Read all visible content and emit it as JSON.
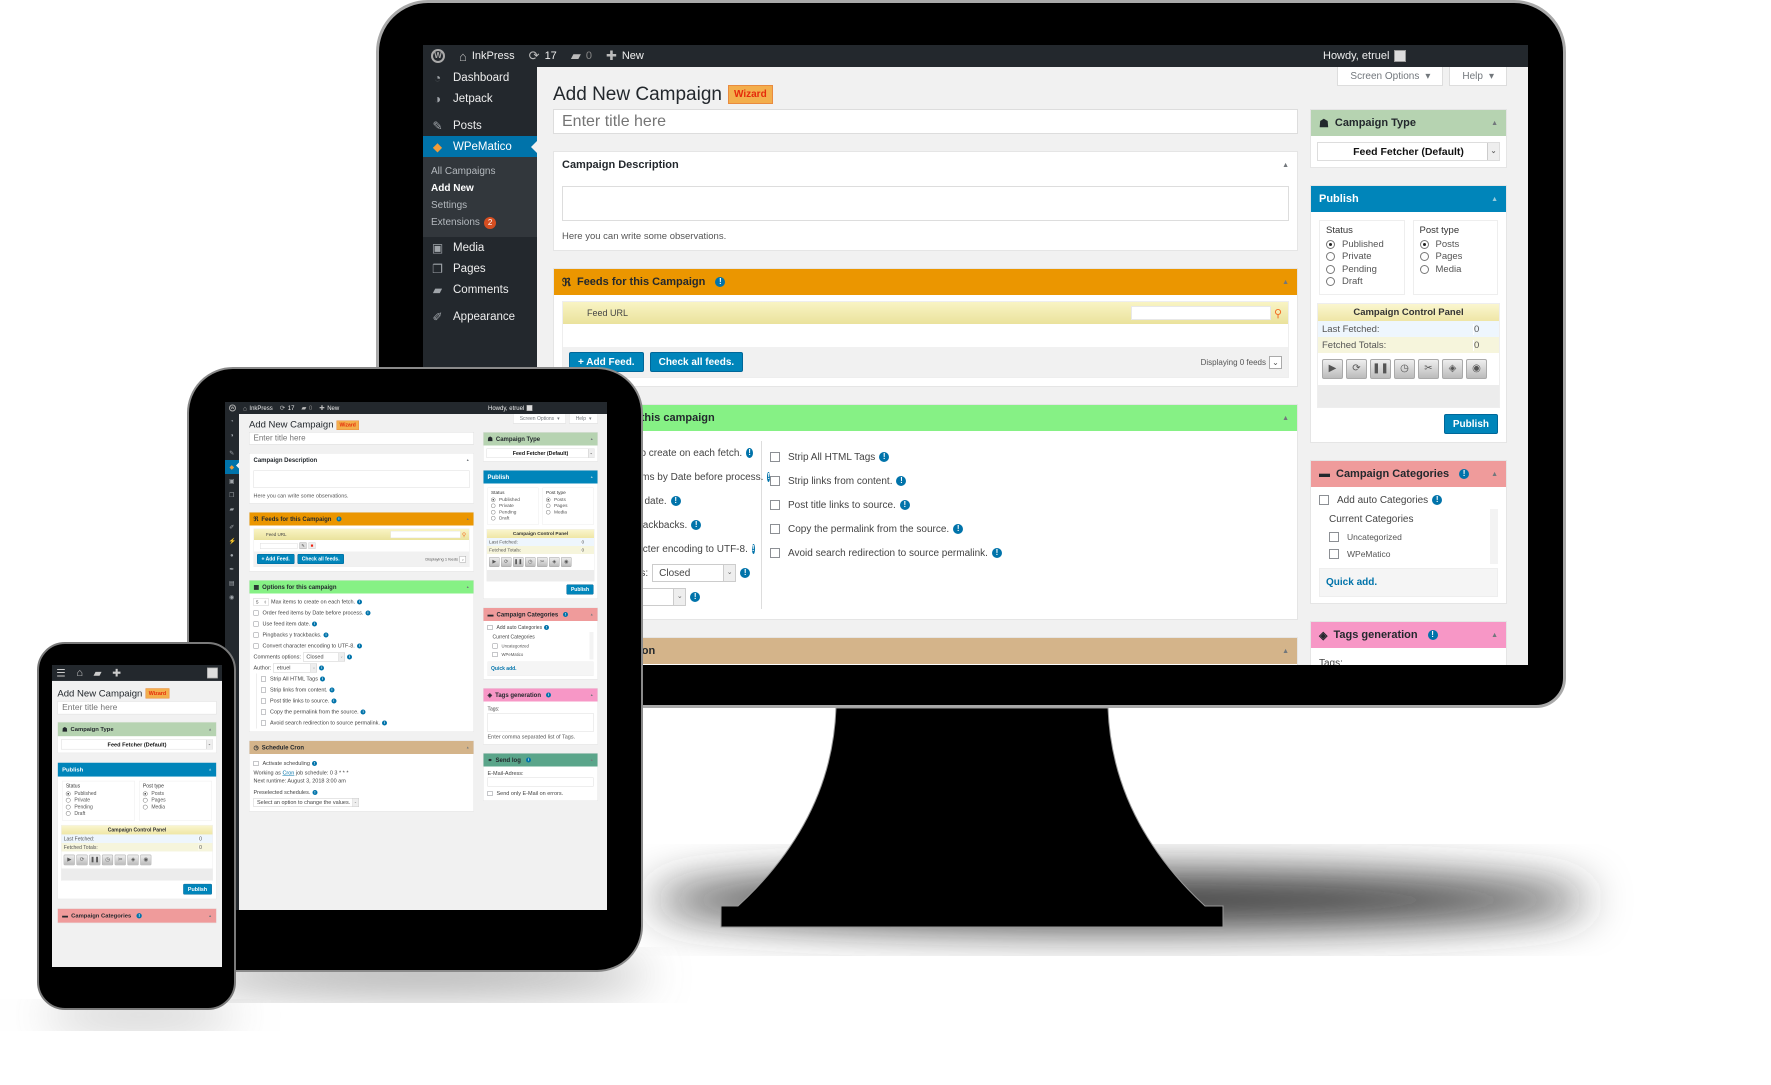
{
  "adminbar": {
    "site": "InkPress",
    "updates": "17",
    "comments": "0",
    "new": "New",
    "howdy": "Howdy, etruel"
  },
  "sidebar": {
    "items": [
      {
        "label": "Dashboard",
        "icon": "dashboard-icon"
      },
      {
        "label": "Jetpack",
        "icon": "jetpack-icon"
      },
      {
        "label": "Posts",
        "icon": "pin-icon"
      },
      {
        "label": "WPeMatico",
        "icon": "wpematico-icon"
      },
      {
        "label": "Media",
        "icon": "media-icon"
      },
      {
        "label": "Pages",
        "icon": "pages-icon"
      },
      {
        "label": "Comments",
        "icon": "comment-icon"
      },
      {
        "label": "Appearance",
        "icon": "brush-icon"
      }
    ],
    "icon_only_items": [
      "plugins-icon",
      "users-icon",
      "tools-icon",
      "settings-icon",
      "collapse-icon"
    ],
    "submenu": [
      "All Campaigns",
      "Add New",
      "Settings",
      "Extensions"
    ],
    "extensions_badge": "2"
  },
  "screen_options": "Screen Options",
  "help": "Help",
  "page_title": "Add New Campaign",
  "wizard": "Wizard",
  "title_placeholder": "Enter title here",
  "description": {
    "title": "Campaign Description",
    "hint": "Here you can write some observations."
  },
  "feeds": {
    "title": "Feeds for this Campaign",
    "feed_url": "Feed URL",
    "add_feed": "+ Add Feed.",
    "check_all": "Check all feeds.",
    "displaying_monitor": "Displaying 0 feeds",
    "displaying_tablet": "Displaying 1 feeds"
  },
  "options": {
    "title": "Options for this campaign",
    "max_items_value": "5",
    "max_items": "Max items to create on each fetch.",
    "checks_left": [
      "Order feed items by Date before process.",
      "Use feed item date.",
      "Pingbacks y trackbacks.",
      "Convert character encoding to UTF-8."
    ],
    "comments_label": "Comments options:",
    "comments_value": "Closed",
    "author_label": "Author:",
    "author_value": "etruel",
    "checks_right": [
      "Strip All HTML Tags",
      "Strip links from content.",
      "Post title links to source.",
      "Copy the permalink from the source.",
      "Avoid search redirection to source permalink."
    ]
  },
  "schedule": {
    "title": "Schedule Cron",
    "activate": "Activate scheduling",
    "working_prefix": "Working as",
    "cron_link": "Cron",
    "working_suffix": "job schedule: 0 3 * * *",
    "next_runtime": "Next runtime: August 3, 2018 3:00 am",
    "preselected": "Preselected schedules.",
    "select_placeholder": "Select an option to change the values."
  },
  "campaign_type": {
    "title": "Campaign Type",
    "value": "Feed Fetcher (Default)"
  },
  "publish": {
    "title": "Publish",
    "status_label": "Status",
    "statuses": [
      "Published",
      "Private",
      "Pending",
      "Draft"
    ],
    "selected_status": "Published",
    "post_type_label": "Post type",
    "post_types": [
      "Posts",
      "Pages",
      "Media"
    ],
    "selected_post_type": "Posts",
    "control_panel": "Campaign Control Panel",
    "last_fetched_label": "Last Fetched:",
    "last_fetched": "0",
    "fetched_totals_label": "Fetched Totals:",
    "fetched_totals": "0",
    "control_buttons": [
      "play-icon",
      "refresh-icon",
      "pause-icon",
      "history-icon",
      "unlink-icon",
      "tag-icon",
      "eye-icon"
    ],
    "button": "Publish"
  },
  "categories": {
    "title": "Campaign Categories",
    "auto": "Add auto Categories",
    "current": "Current Categories",
    "items": [
      "Uncategorized",
      "WPeMatico"
    ],
    "quick_add": "Quick add."
  },
  "tags": {
    "title": "Tags generation",
    "label": "Tags:",
    "hint": "Enter comma separated list of Tags."
  },
  "send_log": {
    "title": "Send log",
    "email_label": "E-Mail-Adress:",
    "errors_only": "Send only E-Mail on errors."
  },
  "colors": {
    "admin_bar": "#23282d",
    "accent": "#0073aa",
    "feeds_header": "#eb9600",
    "options_header": "#86f185",
    "schedule_header": "#d4b48a",
    "campaign_type_header": "#b6d3b1",
    "publish_header": "#0085ba",
    "categories_header": "#ef9b9b",
    "tags_header": "#f797c6",
    "send_log_header": "#5aa58a"
  }
}
